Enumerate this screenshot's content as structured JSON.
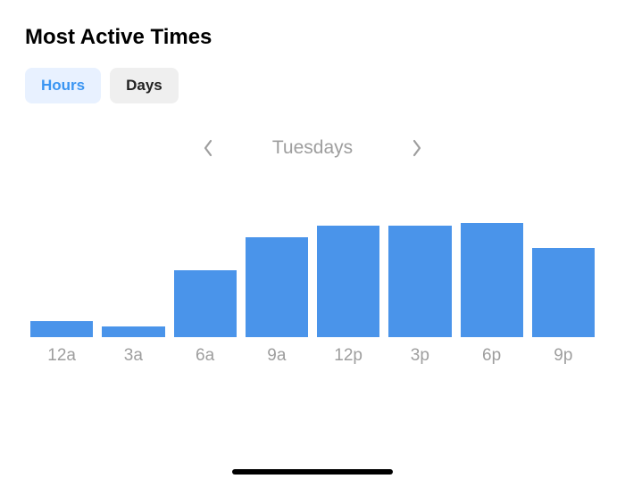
{
  "title": "Most Active Times",
  "tabs": {
    "hours": "Hours",
    "days": "Days",
    "active": "hours"
  },
  "day_nav": {
    "label": "Tuesdays"
  },
  "chart_data": {
    "type": "bar",
    "categories": [
      "12a",
      "3a",
      "6a",
      "9a",
      "12p",
      "3p",
      "6p",
      "9p"
    ],
    "values": [
      18,
      12,
      75,
      112,
      125,
      125,
      128,
      100
    ],
    "title": "Most Active Times",
    "xlabel": "",
    "ylabel": "",
    "ylim": [
      0,
      150
    ],
    "bar_color": "#4a94ea"
  }
}
